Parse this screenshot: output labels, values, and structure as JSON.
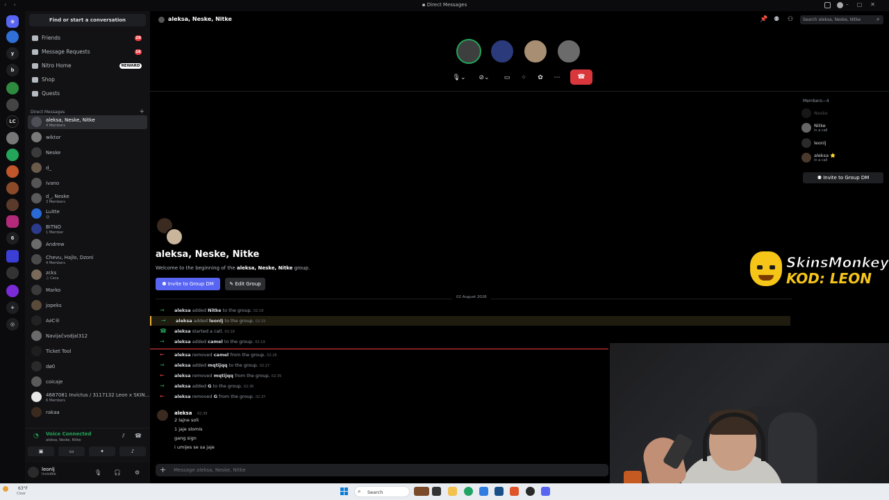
{
  "window": {
    "title": "Direct Messages"
  },
  "rail": {
    "items": [
      "y",
      "b",
      "LC",
      "6"
    ]
  },
  "sidebar": {
    "find_placeholder": "Find or start a conversation",
    "nav": [
      {
        "label": "Friends",
        "badge": "29"
      },
      {
        "label": "Message Requests",
        "badge": "16"
      },
      {
        "label": "Nitro Home",
        "badge": "REWARD"
      },
      {
        "label": "Shop",
        "badge": ""
      },
      {
        "label": "Quests",
        "badge": ""
      }
    ],
    "dm_header": "Direct Messages",
    "dms": [
      {
        "name": "aleksa, Neske, Nitke",
        "sub": "4 Members"
      },
      {
        "name": "wiktor",
        "sub": ""
      },
      {
        "name": "Neske",
        "sub": ""
      },
      {
        "name": "d_",
        "sub": ""
      },
      {
        "name": "ivano",
        "sub": ""
      },
      {
        "name": "d_, Neske",
        "sub": "3 Members"
      },
      {
        "name": "Luitte",
        "sub": "😉"
      },
      {
        "name": "BITNO",
        "sub": "1 Member"
      },
      {
        "name": "Andrew",
        "sub": ""
      },
      {
        "name": "Chevu, Hajlo, Dzoni",
        "sub": "4 Members"
      },
      {
        "name": "zcks",
        "sub": "♫ Ceca"
      },
      {
        "name": "Marko",
        "sub": ""
      },
      {
        "name": "jopeks",
        "sub": ""
      },
      {
        "name": "A∂C®",
        "sub": ""
      },
      {
        "name": "Navijačvodjal312",
        "sub": ""
      },
      {
        "name": "Ticket Tool",
        "sub": ""
      },
      {
        "name": "dø0",
        "sub": ""
      },
      {
        "name": "coicaje",
        "sub": ""
      },
      {
        "name": "4687081 Invictus / 3117132 Leon x SKIN...",
        "sub": "6 Members"
      },
      {
        "name": "rakaa",
        "sub": ""
      }
    ],
    "voice": {
      "title": "Voice Connected",
      "sub": "aleksa, Neske, Nitke"
    },
    "user": {
      "name": "leonlj",
      "status": "Invisible"
    }
  },
  "chat": {
    "title": "aleksa, Neske, Nitke",
    "search_placeholder": "Search aleksa, Neske, Nitke",
    "welcome_title": "aleksa, Neske, Nitke",
    "welcome_sub_pre": "Welcome to the beginning of the",
    "welcome_sub_group": "aleksa, Neske, Nitke",
    "welcome_sub_post": "group.",
    "invite_label": "Invite to Group DM",
    "edit_label": "Edit Group",
    "date": "02 August 2026",
    "events": [
      {
        "dir": "in",
        "actor": "aleksa",
        "verb": "added",
        "target": "Nitke",
        "rest": "to the group.",
        "time": "02:19"
      },
      {
        "dir": "in",
        "actor": "aleksa",
        "verb": "added",
        "target": "leonlj",
        "rest": "to the group.",
        "time": "02:19"
      },
      {
        "dir": "call",
        "actor": "aleksa",
        "verb": "started a call.",
        "target": "",
        "rest": "",
        "time": "02:19"
      },
      {
        "dir": "in",
        "actor": "aleksa",
        "verb": "added",
        "target": "camel",
        "rest": "to the group.",
        "time": "02:19"
      },
      {
        "dir": "out",
        "actor": "aleksa",
        "verb": "removed",
        "target": "camel",
        "rest": "from the group.",
        "time": "02:26"
      },
      {
        "dir": "in",
        "actor": "aleksa",
        "verb": "added",
        "target": "mqtijqq",
        "rest": "to the group.",
        "time": "02:27"
      },
      {
        "dir": "out",
        "actor": "aleksa",
        "verb": "removed",
        "target": "mqtijqq",
        "rest": "from the group.",
        "time": "02:35"
      },
      {
        "dir": "in",
        "actor": "aleksa",
        "verb": "added",
        "target": "G",
        "rest": "to the group.",
        "time": "02:36"
      },
      {
        "dir": "out",
        "actor": "aleksa",
        "verb": "removed",
        "target": "G",
        "rest": "from the group.",
        "time": "02:37"
      }
    ],
    "message": {
      "author": "aleksa",
      "time": "02:39",
      "lines": [
        "2 lajne soli",
        "1 jaje slomis",
        "gang sign",
        "i umijes se sa jaje"
      ]
    },
    "composer_placeholder": "Message aleksa, Neske, Nitke"
  },
  "members": {
    "title": "Members—4",
    "list": [
      {
        "name": "Neske",
        "status": ""
      },
      {
        "name": "Nitke",
        "status": "In a call"
      },
      {
        "name": "leonlj",
        "status": ""
      },
      {
        "name": "aleksa ⭐",
        "status": "In a call"
      }
    ],
    "invite_label": "Invite to Group DM"
  },
  "sponsor": {
    "brand": "SkinsMonkey",
    "code": "KOD: LEON"
  },
  "taskbar": {
    "temp": "63°F",
    "weather": "Clear",
    "search_label": "Search"
  },
  "colors": {
    "accent": "#5865f2",
    "green": "#23a55a",
    "red": "#da373c",
    "badge_red": "#f23f43",
    "sponsor_yellow": "#f5c518"
  }
}
